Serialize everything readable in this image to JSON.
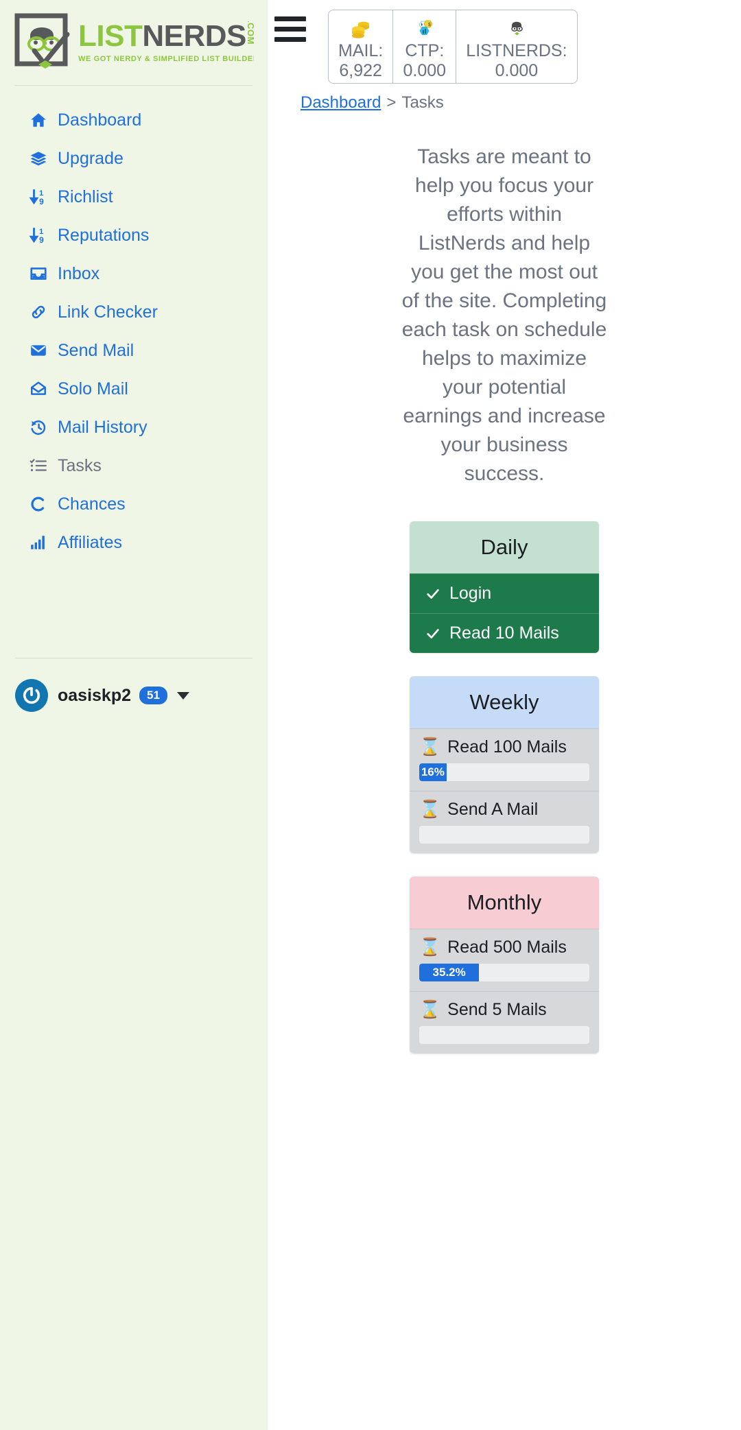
{
  "brand": {
    "name_part1": "LIST",
    "name_part2": "NERDS",
    "dotcom": ".COM",
    "tagline": "WE GOT NERDY & SIMPLIFIED LIST BUILDERS!",
    "accent_green": "#8cc63e",
    "accent_grey": "#58595b"
  },
  "sidebar": {
    "items": [
      {
        "label": "Dashboard",
        "icon": "home-icon",
        "active": false
      },
      {
        "label": "Upgrade",
        "icon": "layers-icon",
        "active": false
      },
      {
        "label": "Richlist",
        "icon": "sort-amount-icon",
        "active": false
      },
      {
        "label": "Reputations",
        "icon": "sort-amount-icon",
        "active": false
      },
      {
        "label": "Inbox",
        "icon": "inbox-icon",
        "active": false
      },
      {
        "label": "Link Checker",
        "icon": "link-icon",
        "active": false
      },
      {
        "label": "Send Mail",
        "icon": "envelope-icon",
        "active": false
      },
      {
        "label": "Solo Mail",
        "icon": "envelope-open-icon",
        "active": false
      },
      {
        "label": "Mail History",
        "icon": "history-icon",
        "active": false
      },
      {
        "label": "Tasks",
        "icon": "tasks-icon",
        "active": true
      },
      {
        "label": "Chances",
        "icon": "spinner-icon",
        "active": false
      },
      {
        "label": "Affiliates",
        "icon": "chart-bars-icon",
        "active": false
      }
    ],
    "user": {
      "name": "oasiskp2",
      "badge": "51",
      "avatar_icon": "power-avatar-icon",
      "caret_icon": "caret-down-icon"
    }
  },
  "topbar": {
    "menu_icon": "hamburger-menu-icon",
    "stats": [
      {
        "icon": "coins-icon",
        "label": "MAIL:",
        "value": "6,922"
      },
      {
        "icon": "ctp-token-icon",
        "label": "CTP:",
        "value": "0.000"
      },
      {
        "icon": "nerd-face-icon",
        "label": "LISTNERDS:",
        "value": "0.000"
      }
    ]
  },
  "breadcrumb": {
    "root": "Dashboard",
    "separator": ">",
    "current": "Tasks"
  },
  "main": {
    "intro": "Tasks are meant to help you focus your efforts within ListNerds and help you get the most out of the site. Completing each task on schedule helps to maximize your potential earnings and increase your business success."
  },
  "task_groups": [
    {
      "title": "Daily",
      "header_color": "#c3e0d1",
      "tasks": [
        {
          "label": "Login",
          "status": "done",
          "icon": "check-icon"
        },
        {
          "label": "Read 10 Mails",
          "status": "done",
          "icon": "check-icon"
        }
      ]
    },
    {
      "title": "Weekly",
      "header_color": "#c5dbf7",
      "tasks": [
        {
          "label": "Read 100 Mails",
          "status": "pending",
          "icon": "hourglass-icon",
          "progress": 16,
          "progress_label": "16%"
        },
        {
          "label": "Send A Mail",
          "status": "pending",
          "icon": "hourglass-icon",
          "progress": 0,
          "progress_label": ""
        }
      ]
    },
    {
      "title": "Monthly",
      "header_color": "#f7ccd2",
      "tasks": [
        {
          "label": "Read 500 Mails",
          "status": "pending",
          "icon": "hourglass-icon",
          "progress": 35.2,
          "progress_label": "35.2%"
        },
        {
          "label": "Send 5 Mails",
          "status": "pending",
          "icon": "hourglass-icon",
          "progress": 0,
          "progress_label": ""
        }
      ]
    }
  ]
}
